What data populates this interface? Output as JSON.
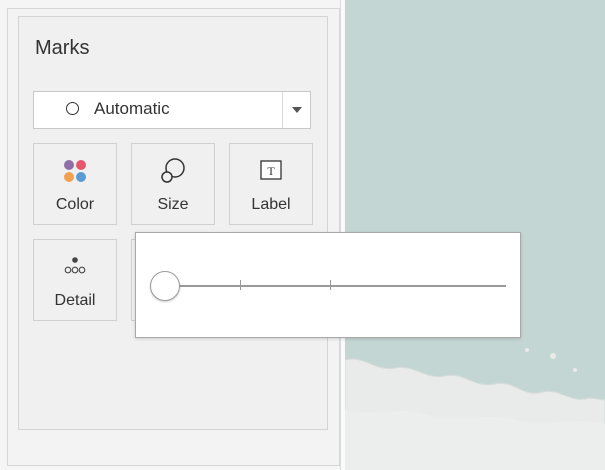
{
  "marks": {
    "title": "Marks",
    "mark_type": {
      "label": "Automatic",
      "icon": "circle-icon",
      "dropdown_icon": "chevron-down-icon"
    },
    "buttons": [
      {
        "label": "Color",
        "icon": "color-dots-icon"
      },
      {
        "label": "Size",
        "icon": "size-shapes-icon"
      },
      {
        "label": "Label",
        "icon": "label-text-icon"
      },
      {
        "label": "Detail",
        "icon": "detail-dots-icon"
      }
    ]
  },
  "size_popup": {
    "slider_value": 0.0,
    "slider_ticks": 3
  },
  "map": {
    "water_color": "#c4d6d3",
    "land_color": "#e8ebea"
  },
  "colors": {
    "dot_purple": "#8e6fa6",
    "dot_red": "#e5576a",
    "dot_orange": "#f0a050",
    "dot_blue": "#5b9bd5"
  }
}
